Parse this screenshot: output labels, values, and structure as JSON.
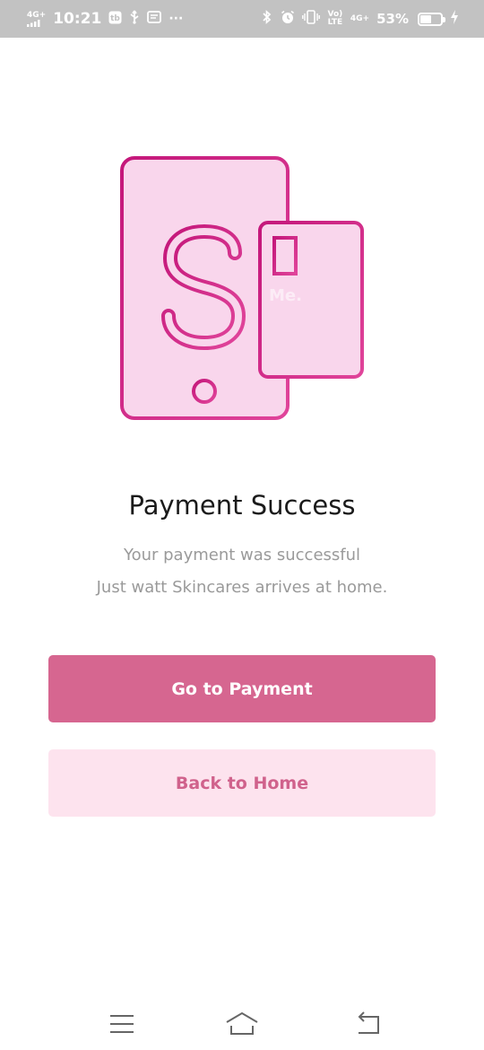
{
  "status_bar": {
    "network_label": "4G+",
    "time": "10:21",
    "more_indicator": "···",
    "volte_label": "Vo) LTE",
    "network_label_2": "4G+",
    "battery_text": "53%",
    "battery_level": 0.53,
    "icons": [
      "signal-icon",
      "app-notification-icon",
      "usb-icon",
      "mail-icon",
      "bluetooth-icon",
      "alarm-icon",
      "vibrate-icon",
      "charging-icon"
    ]
  },
  "illustration": {
    "icon": "phone-dollar-card-icon",
    "watermark": "Me.",
    "colors": {
      "fill": "#f9d6ec",
      "stroke_start": "#c4177a",
      "stroke_end": "#e0449a"
    }
  },
  "content": {
    "title": "Payment Success",
    "subtitle_line1": "Your payment was successful",
    "subtitle_line2": "Just watt Skincares arrives at home."
  },
  "actions": {
    "primary_label": "Go to Payment",
    "secondary_label": "Back to Home",
    "colors": {
      "primary_bg": "#d66690",
      "secondary_bg": "#fde3ee",
      "secondary_text": "#d0628c"
    }
  },
  "nav_bar": {
    "icons": [
      "menu-icon",
      "home-icon",
      "back-icon"
    ]
  }
}
